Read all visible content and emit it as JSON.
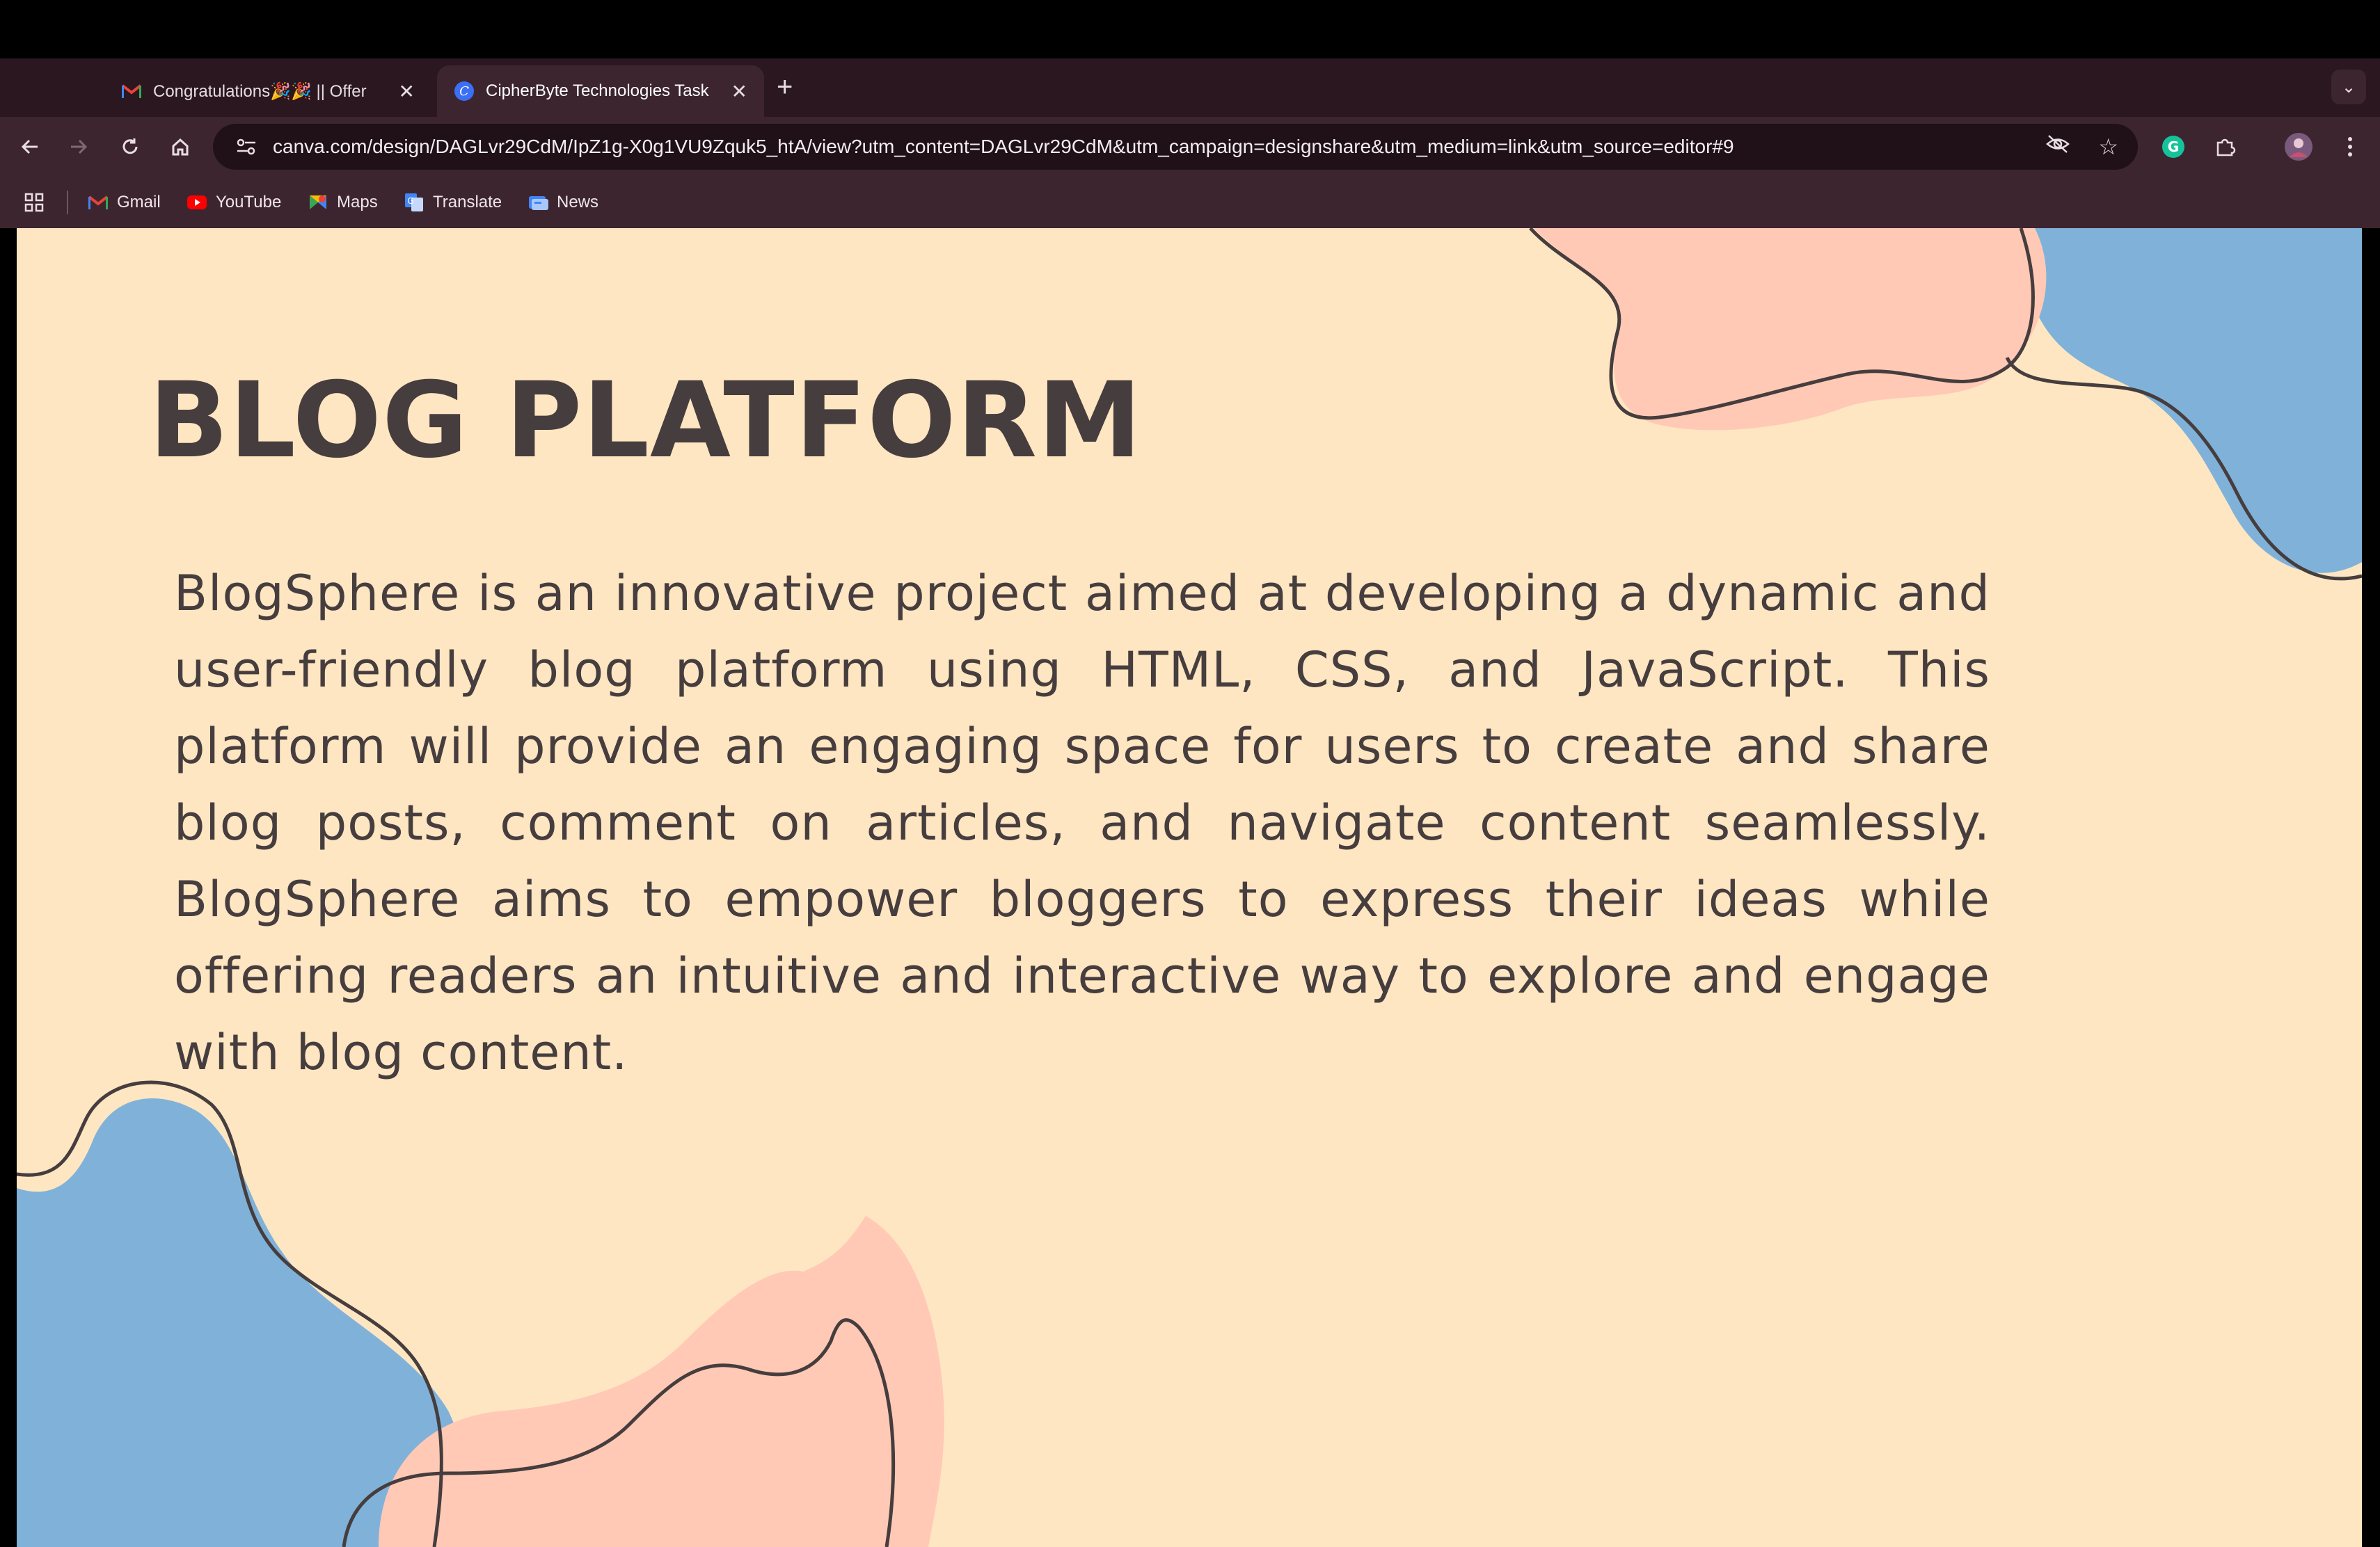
{
  "browser": {
    "tabs": [
      {
        "title": "Congratulations🎉🎉 || Offer",
        "favicon": "gmail-icon",
        "active": false
      },
      {
        "title": "CipherByte Technologies Task",
        "favicon": "canva-icon",
        "active": true
      }
    ],
    "url": "canva.com/design/DAGLvr29CdM/IpZ1g-X0g1VU9Zquk5_htA/view?utm_content=DAGLvr29CdM&utm_campaign=designshare&utm_medium=link&utm_source=editor#9",
    "bookmarks": [
      {
        "label": "Gmail",
        "icon": "gmail-icon"
      },
      {
        "label": "YouTube",
        "icon": "youtube-icon"
      },
      {
        "label": "Maps",
        "icon": "maps-icon"
      },
      {
        "label": "Translate",
        "icon": "translate-icon"
      },
      {
        "label": "News",
        "icon": "news-icon"
      }
    ]
  },
  "slide": {
    "title": "BLOG PLATFORM",
    "body": "BlogSphere is an innovative project aimed at developing a dynamic and user-friendly blog platform using HTML, CSS, and JavaScript. This platform will provide an engaging space for users to create and share blog posts, comment on articles, and navigate content seamlessly. BlogSphere aims to empower bloggers to express their ideas while offering readers an intuitive and interactive way to explore and engage with blog content.",
    "colors": {
      "background": "#ffe6c2",
      "text": "#463d3e",
      "blue_blob": "#80b2d9",
      "peach_blob": "#ffc9b5"
    }
  }
}
